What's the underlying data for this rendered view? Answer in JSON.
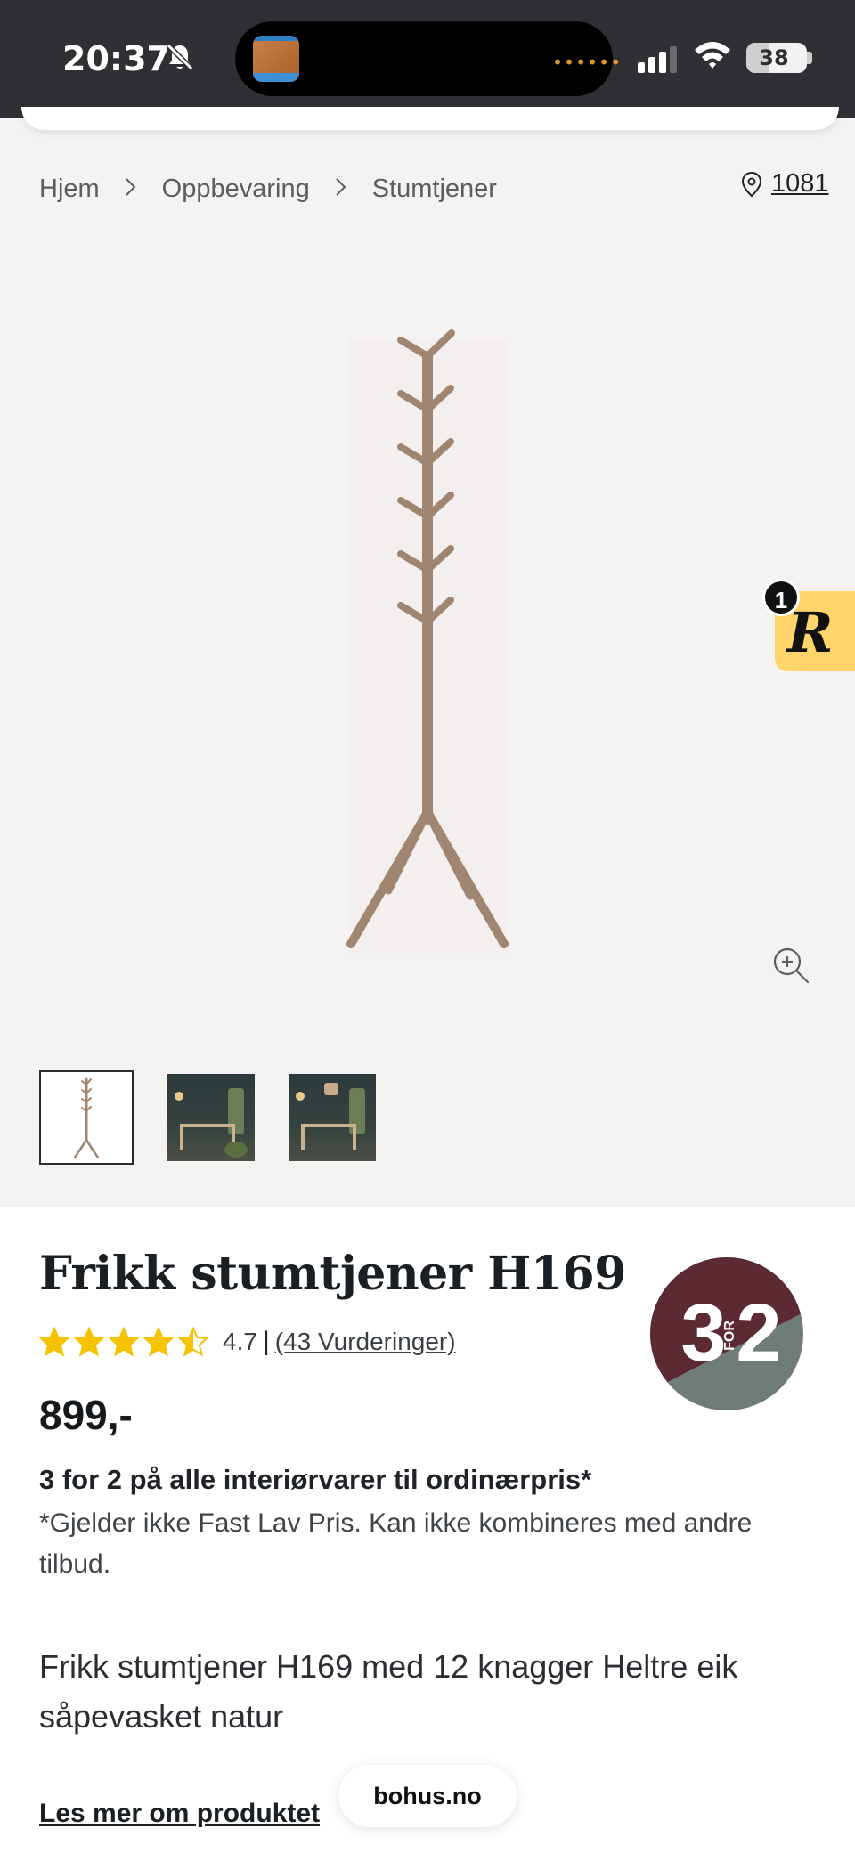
{
  "status_bar": {
    "time": "20:37",
    "battery_level": "38",
    "battery_fraction": 0.38
  },
  "breadcrumb": {
    "items": [
      "Hjem",
      "Oppbevaring",
      "Stumtjener"
    ]
  },
  "location": {
    "postal_code": "1081"
  },
  "reward": {
    "count": "1",
    "letter": "R"
  },
  "product": {
    "title": "Frikk stumtjener H169",
    "rating_value": "4.7",
    "rating_stars": 4.5,
    "rating_count_label": "(43 Vurderinger)",
    "price": "899,-",
    "offer_title": "3 for 2 på alle interiørvarer til ordinærpris*",
    "offer_note": "*Gjelder ikke Fast Lav Pris. Kan ikke kombineres med andre tilbud.",
    "description": "Frikk stumtjener H169 med 12 knagger Heltre eik såpevasket natur",
    "read_more_label": "Les mer om produktet"
  },
  "promo_badge": {
    "left": "3",
    "middle": "FOR",
    "right": "2"
  },
  "browser": {
    "domain": "bohus.no"
  },
  "colors": {
    "status_bar": "#2f3033",
    "gallery_bg": "#f5f3f2",
    "star": "#f7c300",
    "promo_top": "#5c2a33",
    "promo_bottom": "#6f7c79",
    "reward_bg": "#ffd46a",
    "wood": "#a08670"
  },
  "icons": {
    "bell": "bell-slash-icon",
    "signal": "cellular-signal-icon",
    "wifi": "wifi-icon",
    "location": "location-pin-icon",
    "zoom": "zoom-in-icon",
    "breadcrumb_separator": "chevron-right-icon",
    "star": "star-icon"
  }
}
